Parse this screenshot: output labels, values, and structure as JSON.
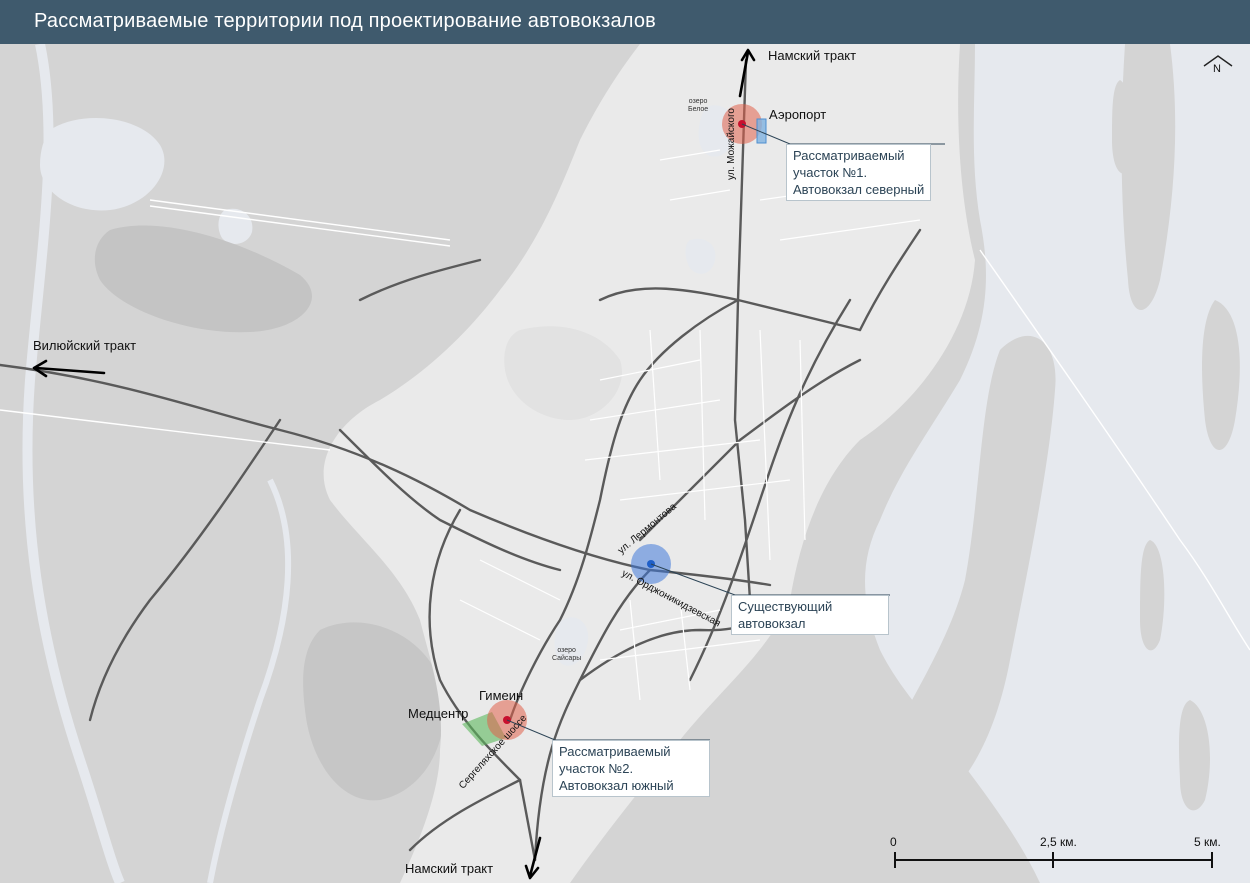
{
  "title": "Рассматриваемые территории под проектирование автовокзалов",
  "north_label": "N",
  "roads": {
    "north": "Намский тракт",
    "west": "Вилюйский тракт",
    "south": "Намский тракт"
  },
  "places": {
    "airport": "Аэропорт",
    "gimein": "Гимеин",
    "medcenter": "Медцентр"
  },
  "lakes": {
    "beloe": [
      "озеро",
      "Белое"
    ],
    "saysary": [
      "озеро",
      "Сайсары"
    ]
  },
  "streets": {
    "mozhaiskogo": "ул. Можайского",
    "lermontova": "ул. Лермонтова",
    "ordzhonikidzevskaya": "ул. Орджоникидзевская",
    "sergelyakhskoe": "Сергеляхское шоссе"
  },
  "callouts": {
    "site1": [
      "Рассматриваемый",
      "участок №1.",
      "Автовокзал северный"
    ],
    "existing": [
      "Существующий",
      "автовокзал"
    ],
    "site2": [
      "Рассматриваемый",
      "участок №2.",
      "Автовокзал южный"
    ]
  },
  "scale": {
    "labels": [
      "0",
      "2,5 км.",
      "5 км."
    ]
  },
  "colors": {
    "header": "#3f5a6d",
    "land": "#d4d4d4",
    "water": "#e6e9ee",
    "city": "#eaeaea",
    "road": "#5a5a5a",
    "proposed_site": "#e0604a",
    "existing_station": "#3f78d8"
  }
}
